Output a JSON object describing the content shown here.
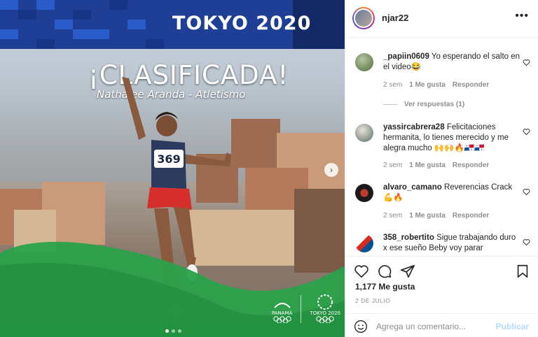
{
  "post": {
    "banner_title": "TOKYO 2020",
    "headline": "¡CLASIFICADA!",
    "subline": "Nathalee Aranda - Atletismo",
    "bib_number": "369",
    "logo_left_text": "PANAMÁ",
    "logo_right_text": "TOKYO 2020",
    "carousel_dots": 3,
    "carousel_active": 1,
    "icon_next": "chevron-right-icon"
  },
  "header": {
    "username": "njar22",
    "more_label": "•••"
  },
  "comments": [
    {
      "user": "_papiin0609",
      "text": "Yo esperando el salto en el video😂",
      "age": "2 sem",
      "likes": "1 Me gusta",
      "reply": "Responder",
      "view_replies": "Ver respuestas (1)"
    },
    {
      "user": "yassircabrera28",
      "text": "Felicitaciones hermanita, lo tienes merecido y me alegra mucho 🙌🙌🔥🇵🇦🇵🇦",
      "age": "2 sem",
      "likes": "1 Me gusta",
      "reply": "Responder"
    },
    {
      "user": "alvaro_camano",
      "text": "Reverencias Crack 💪🔥",
      "age": "2 sem",
      "likes": "1 Me gusta",
      "reply": "Responder"
    },
    {
      "user": "358_robertito",
      "text": "Sigue trabajando duro x ese sueño Beby voy parar"
    }
  ],
  "footer": {
    "likes": "1,177 Me gusta",
    "date": "2 DE JULIO",
    "comment_placeholder": "Agrega un comentario...",
    "publish_label": "Publicar"
  },
  "colors": {
    "banner_blue": "#1f3f97",
    "wave_green": "#2aa14a",
    "publish_disabled": "#b3dbff",
    "meta_gray": "#8e8e8e"
  }
}
